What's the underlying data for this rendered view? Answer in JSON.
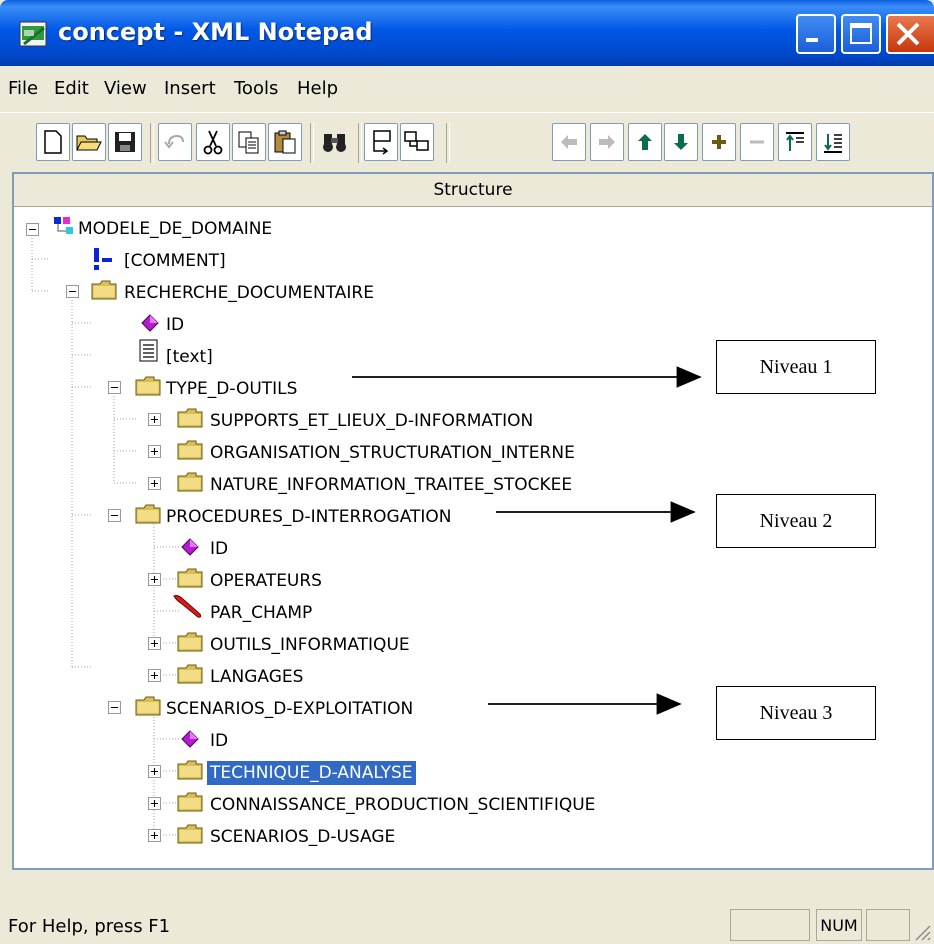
{
  "window": {
    "title": "concept - XML Notepad"
  },
  "menu": [
    "File",
    "Edit",
    "View",
    "Insert",
    "Tools",
    "Help"
  ],
  "panel": {
    "header": "Structure"
  },
  "tree": [
    {
      "label": "MODELE_DE_DOMAINE",
      "icon": "root-element-icon"
    },
    {
      "label": "[COMMENT]",
      "icon": "comment-icon"
    },
    {
      "label": "RECHERCHE_DOCUMENTAIRE",
      "icon": "folder-icon"
    },
    {
      "label": "ID",
      "icon": "attribute-icon"
    },
    {
      "label": "[text]",
      "icon": "text-node-icon"
    },
    {
      "label": "TYPE_D-OUTILS",
      "icon": "folder-icon"
    },
    {
      "label": "SUPPORTS_ET_LIEUX_D-INFORMATION",
      "icon": "folder-icon"
    },
    {
      "label": "ORGANISATION_STRUCTURATION_INTERNE",
      "icon": "folder-icon"
    },
    {
      "label": "NATURE_INFORMATION_TRAITEE_STOCKEE",
      "icon": "folder-icon"
    },
    {
      "label": "PROCEDURES_D-INTERROGATION",
      "icon": "folder-icon"
    },
    {
      "label": "ID",
      "icon": "attribute-icon"
    },
    {
      "label": "OPERATEURS",
      "icon": "folder-icon"
    },
    {
      "label": "PAR_CHAMP",
      "icon": "leaf-element-icon"
    },
    {
      "label": "OUTILS_INFORMATIQUE",
      "icon": "folder-icon"
    },
    {
      "label": "LANGAGES",
      "icon": "folder-icon"
    },
    {
      "label": "SCENARIOS_D-EXPLOITATION",
      "icon": "folder-icon"
    },
    {
      "label": "ID",
      "icon": "attribute-icon"
    },
    {
      "label": "TECHNIQUE_D-ANALYSE",
      "icon": "folder-icon",
      "selected": true
    },
    {
      "label": "CONNAISSANCE_PRODUCTION_SCIENTIFIQUE",
      "icon": "folder-icon"
    },
    {
      "label": "SCENARIOS_D-USAGE",
      "icon": "folder-icon"
    }
  ],
  "annotations": [
    {
      "label": "Niveau 1"
    },
    {
      "label": "Niveau 2"
    },
    {
      "label": "Niveau 3"
    }
  ],
  "status": {
    "help": "For Help, press F1",
    "num": "NUM"
  },
  "colors": {
    "titlebar": "#0058e6",
    "selection": "#316ac5",
    "folder": "#e8d27a",
    "attribute": "#b61ad1"
  }
}
